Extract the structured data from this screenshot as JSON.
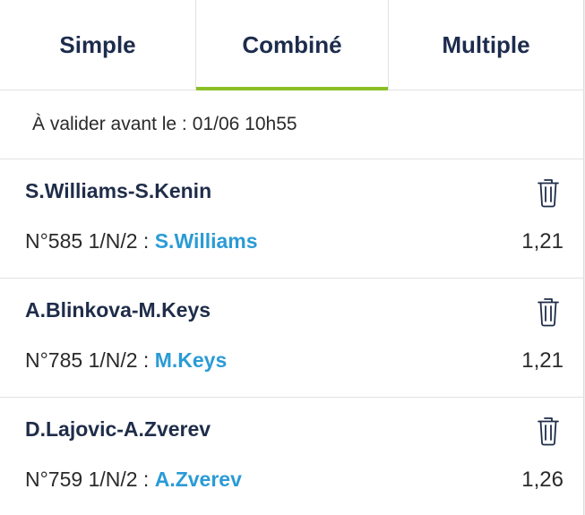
{
  "tabs": [
    {
      "label": "Simple",
      "active": false
    },
    {
      "label": "Combiné",
      "active": true
    },
    {
      "label": "Multiple",
      "active": false
    }
  ],
  "deadline": {
    "label": "À valider avant le :",
    "value": "01/06 10h55"
  },
  "bets": [
    {
      "match": "S.Williams-S.Kenin",
      "pick_prefix": "N°585 1/N/2 : ",
      "selection": "S.Williams",
      "odds": "1,21"
    },
    {
      "match": "A.Blinkova-M.Keys",
      "pick_prefix": "N°785 1/N/2 : ",
      "selection": "M.Keys",
      "odds": "1,21"
    },
    {
      "match": "D.Lajovic-A.Zverev",
      "pick_prefix": "N°759 1/N/2 : ",
      "selection": "A.Zverev",
      "odds": "1,26"
    }
  ],
  "colors": {
    "accent": "#8cbf26",
    "selection": "#2b9bd6",
    "title": "#1d2c4d"
  },
  "icons": {
    "delete": "trash-icon"
  }
}
